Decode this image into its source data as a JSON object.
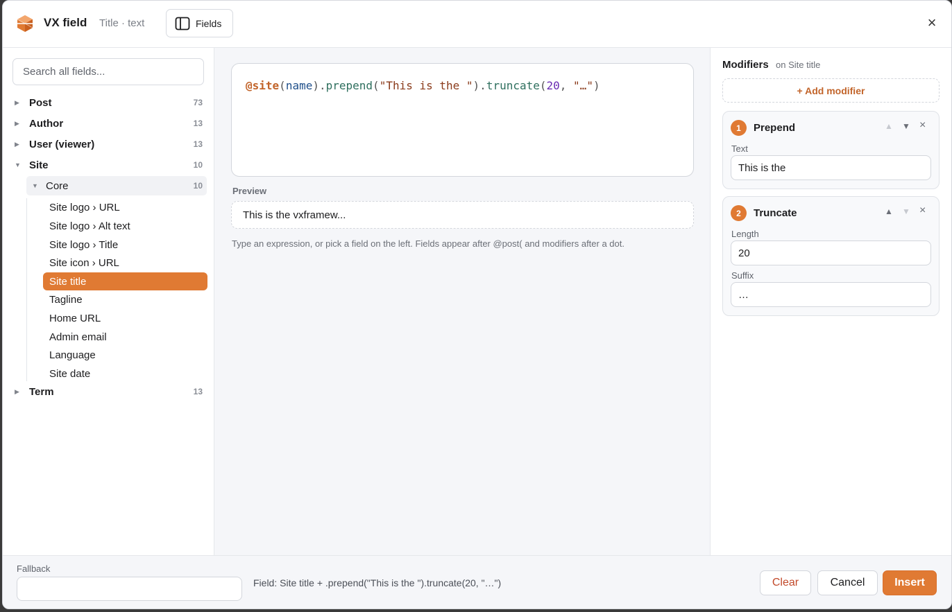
{
  "header": {
    "title": "VX field",
    "subtitle": "Title · text",
    "fields_button": "Fields",
    "close_glyph": "×",
    "icons": {
      "logo": "cube-logo-icon",
      "fields": "sidebar-panel-icon",
      "close": "close-icon"
    }
  },
  "left": {
    "search_placeholder": "Search all fields...",
    "groups": [
      {
        "label": "Post",
        "count": "73",
        "expanded": false
      },
      {
        "label": "Author",
        "count": "13",
        "expanded": false
      },
      {
        "label": "User (viewer)",
        "count": "13",
        "expanded": false
      },
      {
        "label": "Site",
        "count": "10",
        "expanded": true
      },
      {
        "label": "Term",
        "count": "13",
        "expanded": false
      }
    ],
    "subgroup": {
      "label": "Core",
      "count": "10"
    },
    "leaves": [
      "Site logo › URL",
      "Site logo › Alt text",
      "Site logo › Title",
      "Site icon › URL",
      "Site title",
      "Tagline",
      "Home URL",
      "Admin email",
      "Language",
      "Site date"
    ],
    "active_leaf": "Site title"
  },
  "center": {
    "expression": {
      "at": "@site",
      "p1": "(",
      "id": "name",
      "p2": ").",
      "m1": "prepend",
      "p3": "(",
      "s1": "\"This is the \"",
      "p4": ").",
      "m2": "truncate",
      "p5": "(",
      "n1": "20",
      "p6": ", ",
      "s2": "\"…\"",
      "p7": ")"
    },
    "preview_label": "Preview",
    "preview_value": "This is the vxframew...",
    "hint": "Type an expression, or pick a field on the left. Fields appear after @post( and modifiers after a dot."
  },
  "right": {
    "title": "Modifiers",
    "on": "on Site title",
    "add_button": "+ Add modifier",
    "modifiers": [
      {
        "num": "1",
        "name": "Prepend",
        "up": "▲",
        "down": "▼",
        "remove": "×",
        "fields": [
          {
            "label": "Text",
            "value": "This is the"
          }
        ]
      },
      {
        "num": "2",
        "name": "Truncate",
        "up": "▲",
        "down": "▼",
        "remove": "×",
        "fields": [
          {
            "label": "Length",
            "value": "20"
          },
          {
            "label": "Suffix",
            "value": "…"
          }
        ]
      }
    ]
  },
  "footer": {
    "fallback_label": "Fallback",
    "fallback_value": "",
    "summary": "Field: Site title + .prepend(\"This is the \").truncate(20, \"…\")",
    "clear": "Clear",
    "cancel": "Cancel",
    "insert": "Insert"
  },
  "colors": {
    "accent": "#e07a33",
    "danger": "#c2492a"
  }
}
